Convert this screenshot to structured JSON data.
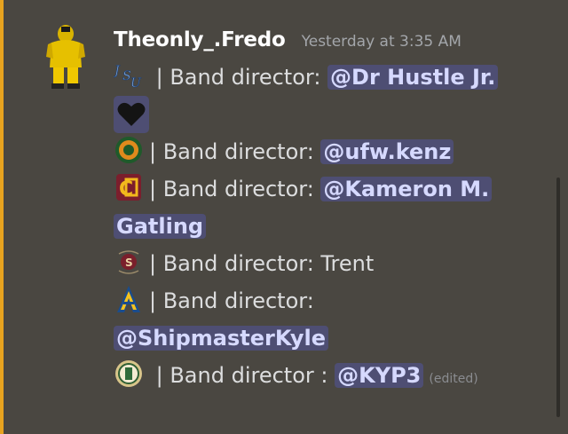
{
  "message": {
    "username": "Theonly_.Fredo",
    "timestamp": "Yesterday at 3:35 AM",
    "edited_label": "(edited)",
    "lines": [
      {
        "icon": "jsu-logo-icon",
        "prefix": " | Band director: ",
        "mention": "@Dr Hustle Jr."
      },
      {
        "icon": "black-heart-icon",
        "prefix": "",
        "mention": ""
      },
      {
        "icon": "famu-seal-icon",
        "prefix": "| Band director: ",
        "mention": "@ufw.kenz"
      },
      {
        "icon": "bethune-cookman-logo-icon",
        "prefix": "| Band director: ",
        "mention": "@Kameron M."
      },
      {
        "icon": "",
        "prefix": "",
        "mention": "Gatling"
      },
      {
        "icon": "texas-southern-seal-icon",
        "prefix": "| Band director: Trent",
        "mention": ""
      },
      {
        "icon": "nc-at-logo-icon",
        "prefix": "| Band director:",
        "mention": ""
      },
      {
        "icon": "",
        "prefix": "",
        "mention": "@ShipmasterKyle"
      },
      {
        "icon": "tennessee-state-seal-icon",
        "prefix": " | Band director : ",
        "mention": "@KYP3"
      }
    ]
  }
}
